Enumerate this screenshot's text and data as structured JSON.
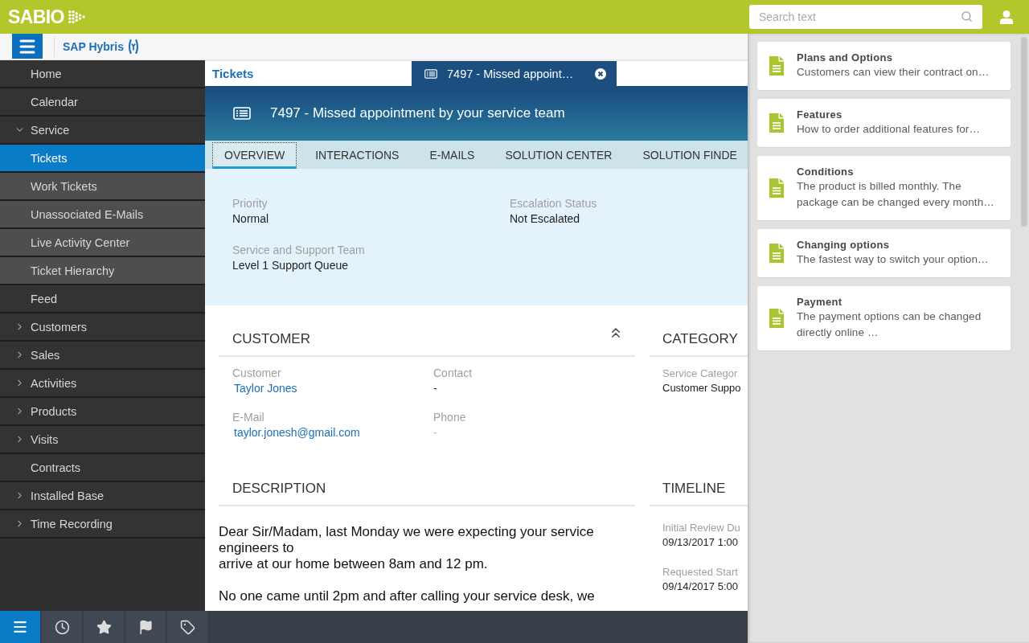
{
  "top_bar": {
    "logo": "SABIO",
    "search": {
      "placeholder": "Search text"
    }
  },
  "app_header": {
    "product": "SAP Hybris"
  },
  "sidebar": {
    "items": [
      {
        "label": "Home",
        "selected": false
      },
      {
        "label": "Calendar",
        "selected": false
      },
      {
        "label": "Service",
        "selected": false,
        "expanded": true,
        "children": [
          {
            "label": "Tickets",
            "selected": true
          },
          {
            "label": "Work Tickets",
            "selected": false
          },
          {
            "label": "Unassociated E-Mails",
            "selected": false
          },
          {
            "label": "Live Activity Center",
            "selected": false
          },
          {
            "label": "Ticket Hierarchy",
            "selected": false
          }
        ]
      },
      {
        "label": "Feed",
        "selected": false
      },
      {
        "label": "Customers",
        "selected": false,
        "expanded": false
      },
      {
        "label": "Sales",
        "selected": false,
        "expanded": false
      },
      {
        "label": "Activities",
        "selected": false,
        "expanded": false
      },
      {
        "label": "Products",
        "selected": false,
        "expanded": false
      },
      {
        "label": "Visits",
        "selected": false,
        "expanded": false
      },
      {
        "label": "Contracts",
        "selected": false
      },
      {
        "label": "Installed Base",
        "selected": false,
        "expanded": false
      },
      {
        "label": "Time Recording",
        "selected": false,
        "expanded": false
      }
    ]
  },
  "bottom_toolbar": {
    "buttons": [
      {
        "kind": "menu",
        "selected": true
      },
      {
        "kind": "recent",
        "selected": false
      },
      {
        "kind": "favorites",
        "selected": false
      },
      {
        "kind": "flags",
        "selected": false
      },
      {
        "kind": "tags",
        "selected": false
      }
    ]
  },
  "doc_tabs": [
    {
      "kind": "list",
      "label": "Tickets",
      "selected": false
    },
    {
      "kind": "record",
      "label": "7497 - Missed appoint…",
      "selected": true
    }
  ],
  "ticket_header": {
    "title": "7497 - Missed appointment by your service team"
  },
  "section_tabs": [
    {
      "label": "OVERVIEW",
      "selected": true
    },
    {
      "label": "INTERACTIONS",
      "selected": false
    },
    {
      "label": "E-MAILS",
      "selected": false
    },
    {
      "label": "SOLUTION CENTER",
      "selected": false
    },
    {
      "label": "SOLUTION FINDE",
      "selected": false
    }
  ],
  "summary": {
    "fields": [
      {
        "label": "Priority",
        "value": "Normal"
      },
      {
        "label": "Escalation Status",
        "value": "Not Escalated"
      },
      {
        "label": "Service and Support Team",
        "value": "Level 1 Support Queue"
      }
    ]
  },
  "customer_section": {
    "title": "CUSTOMER",
    "expanded": true,
    "fields": [
      {
        "label": "Customer",
        "value": "Taylor Jones",
        "kind": "link"
      },
      {
        "label": "Contact",
        "value": "-",
        "kind": "text"
      },
      {
        "label": "E-Mail",
        "value": "taylor.jonesh@gmail.com",
        "kind": "link"
      },
      {
        "label": "Phone",
        "value": "-",
        "kind": "empty"
      }
    ]
  },
  "category_section": {
    "title": "CATEGORY",
    "fields": [
      {
        "label": "Service Categor",
        "value": "Customer Suppo"
      }
    ]
  },
  "description_section": {
    "title": "DESCRIPTION",
    "paragraphs": [
      "Dear Sir/Madam, last Monday we were expecting your service engineers to\narrive at our home between 8am and 12 pm.",
      "No one came until 2pm and after calling your service desk, we"
    ]
  },
  "timeline_section": {
    "title": "TIMELINE",
    "fields": [
      {
        "label": "Initial Review Du",
        "value": "09/13/2017 1:00"
      },
      {
        "label": "Requested Start",
        "value": "09/14/2017 5:00"
      }
    ]
  },
  "knowledge_panel": {
    "articles": [
      {
        "title": "Plans and Options",
        "summary": "Customers can view their contract on…"
      },
      {
        "title": "Features",
        "summary": "How to order additional features for…"
      },
      {
        "title": "Conditions",
        "summary": "The product is billed monthly. The package can be changed every month…"
      },
      {
        "title": "Changing options",
        "summary": "The fastest way to switch your option…"
      },
      {
        "title": "Payment",
        "summary": "The payment options can be changed directly online …"
      }
    ]
  }
}
